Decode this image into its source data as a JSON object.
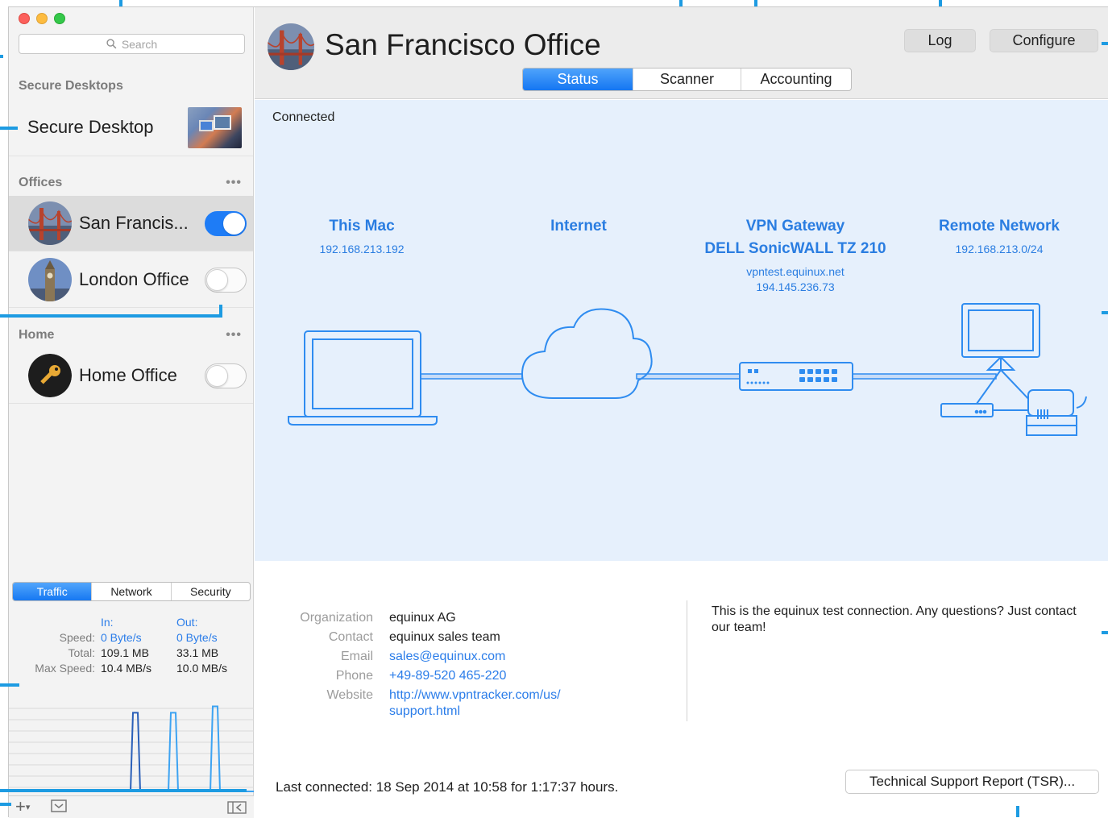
{
  "sidebar": {
    "search_placeholder": "Search",
    "secure_desktops_label": "Secure Desktops",
    "secure_desktop_name": "Secure Desktop",
    "offices_label": "Offices",
    "more_glyph": "•••",
    "offices": [
      {
        "name": "San Francis...",
        "enabled": true,
        "selected": true
      },
      {
        "name": "London Office",
        "enabled": false,
        "selected": false
      }
    ],
    "home_label": "Home",
    "home": [
      {
        "name": "Home Office",
        "enabled": false
      }
    ],
    "stats_tabs": [
      "Traffic",
      "Network",
      "Security"
    ],
    "stats_active_tab": "Traffic",
    "stats": {
      "in_header": "In:",
      "out_header": "Out:",
      "speed_label": "Speed:",
      "speed_in": "0 Byte/s",
      "speed_out": "0 Byte/s",
      "total_label": "Total:",
      "total_in": "109.1 MB",
      "total_out": "33.1 MB",
      "max_label": "Max Speed:",
      "max_in": "10.4 MB/s",
      "max_out": "10.0 MB/s"
    },
    "traffic_graph": {
      "in_peaks": [
        0.88,
        0.0,
        0.0
      ],
      "out_peaks": [
        0.0,
        0.88,
        0.95
      ]
    },
    "bottom_add": "+",
    "bottom_add_caret": "▾"
  },
  "main": {
    "title": "San Francisco Office",
    "tabs": [
      "Status",
      "Scanner",
      "Accounting"
    ],
    "active_tab": "Status",
    "log_button": "Log",
    "configure_button": "Configure",
    "status_text": "Connected",
    "nodes": {
      "mac": {
        "title": "This Mac",
        "sub": "192.168.213.192"
      },
      "internet": {
        "title": "Internet"
      },
      "gateway": {
        "title": "VPN Gateway",
        "model": "DELL SonicWALL TZ 210",
        "host": "vpntest.equinux.net",
        "ip": "194.145.236.73"
      },
      "remote": {
        "title": "Remote Network",
        "sub": "192.168.213.0/24"
      }
    },
    "info": {
      "organization_label": "Organization",
      "organization": "equinux AG",
      "contact_label": "Contact",
      "contact": "equinux sales team",
      "email_label": "Email",
      "email": "sales@equinux.com",
      "phone_label": "Phone",
      "phone": "+49-89-520 465-220",
      "website_label": "Website",
      "website_line1": "http://www.vpntracker.com/us/",
      "website_line2": "support.html",
      "note": "This is the equinux test connection. Any questions? Just contact our team!",
      "last_connected": "Last connected: 18 Sep 2014 at 10:58 for 1:17:37 hours.",
      "tsr_button": "Technical Support Report (TSR)..."
    }
  },
  "colors": {
    "accent": "#1e7cf6",
    "diagram_bg": "#e6f0fc",
    "diagram_line": "#2f8cf0",
    "callout": "#1d9be2"
  }
}
